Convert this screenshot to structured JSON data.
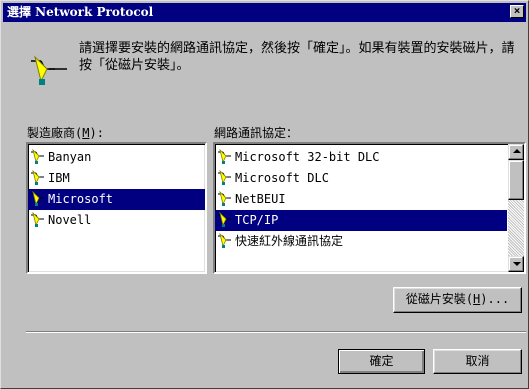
{
  "window": {
    "title": "選擇 Network Protocol",
    "close_label": "×"
  },
  "header": {
    "instruction": "請選擇要安裝的網路通訊協定，然後按「確定」。如果有裝置的安裝磁片，請按「從磁片安裝」。",
    "icon": "network-protocol-icon"
  },
  "manufacturers": {
    "label_pre": "製造廠商(",
    "label_key": "M",
    "label_post": "):",
    "items": [
      "Banyan",
      "IBM",
      "Microsoft",
      "Novell"
    ],
    "selected_index": 2
  },
  "protocols": {
    "label": "網路通訊協定：",
    "items": [
      "Microsoft 32-bit DLC",
      "Microsoft DLC",
      "NetBEUI",
      "TCP/IP",
      "快速紅外線通訊協定"
    ],
    "selected_index": 3
  },
  "buttons": {
    "have_disk_pre": "從磁片安裝(",
    "have_disk_key": "H",
    "have_disk_post": ")...",
    "ok": "確定",
    "cancel": "取消"
  },
  "colors": {
    "titlebar": "#000080",
    "face": "#c0c0c0",
    "selection": "#000080",
    "protocol_icon_yellow": "#ffff00"
  }
}
